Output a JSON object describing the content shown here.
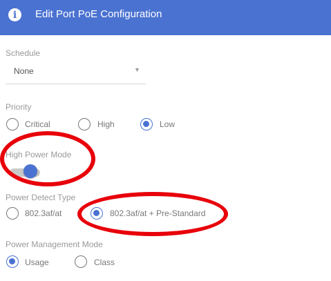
{
  "dialog": {
    "title": "Edit Port PoE Configuration",
    "title_icon": "info-icon"
  },
  "schedule": {
    "label": "Schedule",
    "value": "None"
  },
  "priority": {
    "label": "Priority",
    "options": [
      "Critical",
      "High",
      "Low"
    ],
    "selected": "Low"
  },
  "high_power_mode": {
    "label": "High Power Mode",
    "enabled": true
  },
  "power_detect_type": {
    "label": "Power Detect Type",
    "options": [
      "802.3af/at",
      "802.3af/at + Pre-Standard"
    ],
    "selected": "802.3af/at + Pre-Standard"
  },
  "power_management_mode": {
    "label": "Power Management Mode",
    "options": [
      "Usage",
      "Class"
    ],
    "selected": "Usage"
  },
  "colors": {
    "accent": "#4a72d1",
    "annotation": "#e8000a"
  }
}
